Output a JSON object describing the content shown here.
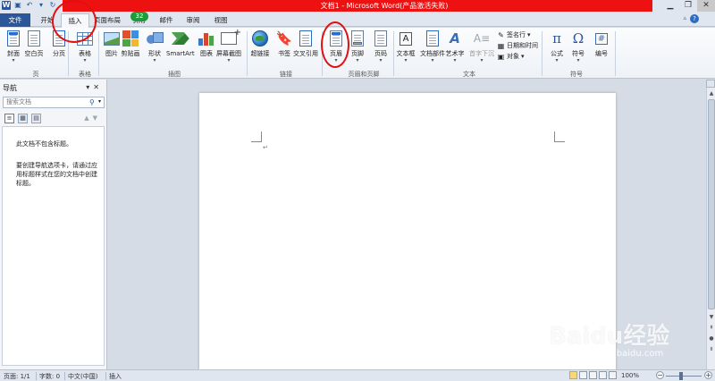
{
  "titlebar": {
    "title": "文档1 - Microsoft Word(产品激活失败)",
    "minimize": "▁",
    "restore": "❐",
    "close": "✕"
  },
  "tabs": {
    "file": "文件",
    "home": "开始",
    "insert": "插入",
    "layout": "页面布局",
    "references": "引用",
    "mailings": "邮件",
    "review": "审阅",
    "view": "视图",
    "badge": "32"
  },
  "ribbon": {
    "pages": {
      "cover": "封面",
      "blank": "空白页",
      "break": "分页",
      "group": "页"
    },
    "tables": {
      "table": "表格",
      "group": "表格"
    },
    "illustrations": {
      "picture": "图片",
      "clipart": "剪贴画",
      "shapes": "形状",
      "smartart": "SmartArt",
      "chart": "图表",
      "screenshot": "屏幕截图",
      "group": "插图"
    },
    "links": {
      "hyperlink": "超链接",
      "bookmark": "书签",
      "crossref": "交叉引用",
      "group": "链接"
    },
    "headerfooter": {
      "header": "页眉",
      "footer": "页脚",
      "pagenum": "页码",
      "group": "页眉和页脚"
    },
    "text": {
      "textbox": "文本框",
      "quickparts": "文档部件",
      "wordart": "艺术字",
      "dropcap": "首字下沉",
      "signature": "签名行",
      "datetime": "日期和时间",
      "object": "对象",
      "group": "文本"
    },
    "symbols": {
      "equation": "公式",
      "symbol": "符号",
      "number": "编号",
      "group": "符号"
    }
  },
  "nav": {
    "title": "导航",
    "search_placeholder": "搜索文档",
    "msg1": "此文档不包含标题。",
    "msg2": "要创建导航选项卡，请通过应用标题样式在您的文档中创建标题。"
  },
  "status": {
    "page": "页面: 1/1",
    "words": "字数: 0",
    "lang": "中文(中国)",
    "mode": "插入",
    "zoom": "100%"
  },
  "watermark": {
    "brand": "Baidu经验",
    "url": "jingyan.baidu.com"
  }
}
